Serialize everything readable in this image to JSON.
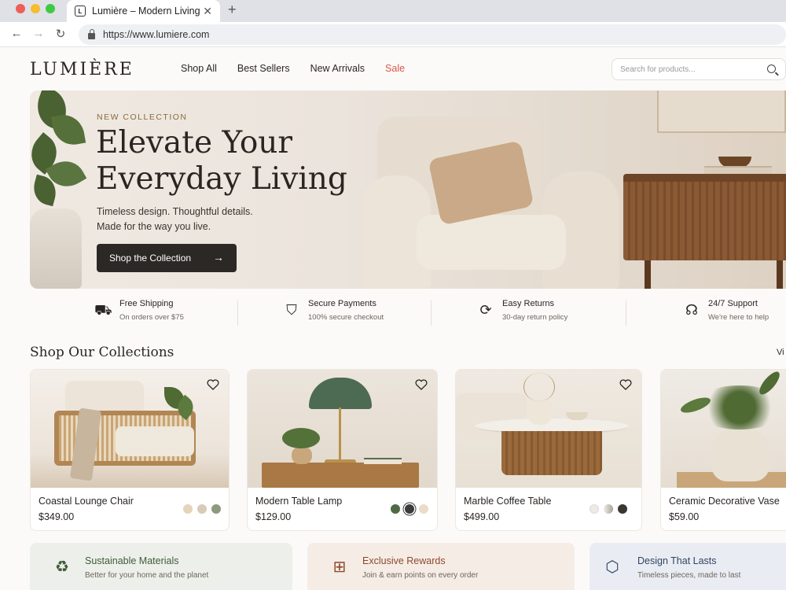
{
  "browser": {
    "tab_title": "Lumière – Modern Living",
    "tab_favicon": "L",
    "url": "https://www.lumiere.com",
    "window_dot_colors": [
      "#ee5f57",
      "#f5bd30",
      "#3ec943"
    ]
  },
  "header": {
    "logo": "LUMIÈRE",
    "nav": [
      "Shop All",
      "Best Sellers",
      "New Arrivals",
      "Sale"
    ],
    "search_placeholder": "Search for products..."
  },
  "hero": {
    "eyebrow": "NEW COLLECTION",
    "title_line1": "Elevate Your",
    "title_line2": "Everyday Living",
    "subtitle_line1": "Timeless design. Thoughtful details.",
    "subtitle_line2": "Made for the way you live.",
    "cta": "Shop the Collection"
  },
  "features": [
    {
      "icon": "truck-icon",
      "title": "Free Shipping",
      "subtitle": "On orders over $75"
    },
    {
      "icon": "shield-check-icon",
      "title": "Secure Payments",
      "subtitle": "100% secure checkout"
    },
    {
      "icon": "refresh-icon",
      "title": "Easy Returns",
      "subtitle": "30-day return policy"
    },
    {
      "icon": "headset-icon",
      "title": "24/7 Support",
      "subtitle": "We're here to help"
    }
  ],
  "collections": {
    "title": "Shop Our Collections",
    "view_all": "Vi",
    "products": [
      {
        "name": "Coastal Lounge Chair",
        "price": "$349.00",
        "swatches": [
          "#e6d3bb",
          "#d9cbb5",
          "#8e9a7f"
        ]
      },
      {
        "name": "Modern Table Lamp",
        "price": "$129.00",
        "swatches": [
          "#4f6b45",
          "#3b3b3b",
          "#eadcc8"
        ]
      },
      {
        "name": "Marble Coffee Table",
        "price": "$499.00",
        "swatches": [
          "#eeeae3",
          "#cfc8bf",
          "#3a3632"
        ]
      },
      {
        "name": "Ceramic Decorative Vase",
        "price": "$59.00",
        "swatches": []
      }
    ]
  },
  "benefits": [
    {
      "icon": "recycle-icon",
      "title": "Sustainable Materials",
      "subtitle": "Better for your home and the planet",
      "bg": "#edf0ea",
      "color": "#3f5a38"
    },
    {
      "icon": "gift-icon",
      "title": "Exclusive Rewards",
      "subtitle": "Join & earn points on every order",
      "bg": "#f6ece6",
      "color": "#8b4a2b"
    },
    {
      "icon": "box-icon",
      "title": "Design That Lasts",
      "subtitle": "Timeless pieces, made to last",
      "bg": "#e9edf3",
      "color": "#2f4463"
    }
  ]
}
